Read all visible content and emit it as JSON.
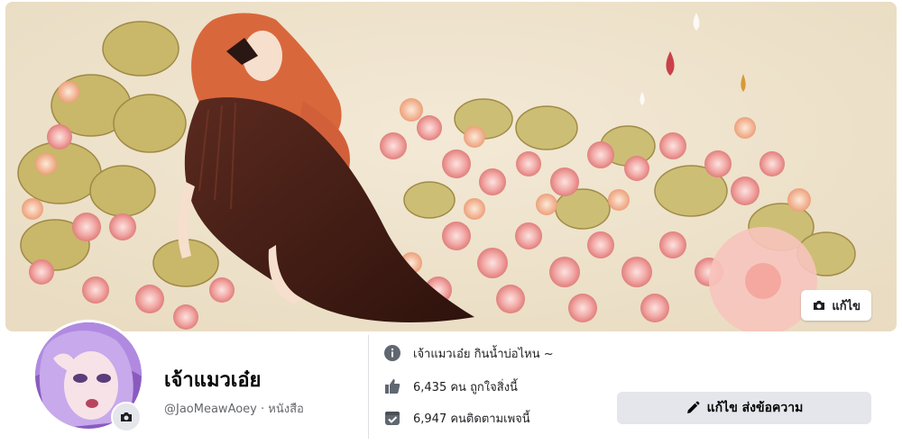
{
  "cover": {
    "edit_label": "แก้ไข"
  },
  "profile": {
    "name": "เจ้าแมวเอ๋ย",
    "username": "@JaoMeawAoey",
    "separator": " · ",
    "category": "หนังสือ"
  },
  "about": {
    "description": "เจ้าแมวเอ๋ย กินน้ำบ่อไหน ~",
    "likes": "6,435 คน ถูกใจสิ่งนี้",
    "followers": "6,947 คนติดตามเพจนี้"
  },
  "actions": {
    "edit_send_message": "แก้ไข ส่งข้อความ"
  },
  "colors": {
    "icon_gray": "#606770",
    "button_bg": "#e4e6eb",
    "divider": "#dddfe2"
  }
}
